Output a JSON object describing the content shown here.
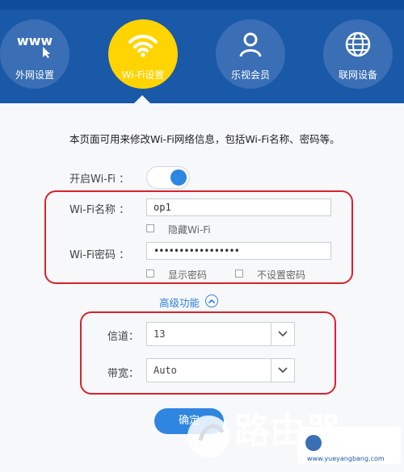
{
  "nav": {
    "items": [
      {
        "label": "外网设置",
        "icon": "www-icon",
        "active": false
      },
      {
        "label": "Wi-Fi设置",
        "icon": "wifi-icon",
        "active": true
      },
      {
        "label": "乐视会员",
        "icon": "user-icon",
        "active": false
      },
      {
        "label": "联网设备",
        "icon": "globe-icon",
        "active": false
      }
    ]
  },
  "page": {
    "description": "本页面可用来修改Wi-Fi网络信息，包括Wi-Fi名称、密码等。"
  },
  "wifi": {
    "toggle_label": "开启Wi-Fi ：",
    "enabled": true,
    "name_label": "Wi-Fi名称 ：",
    "name_value": "op1",
    "hide_label": "隐藏Wi-Fi",
    "password_label": "Wi-Fi密码 ：",
    "password_value": "•••••••••••••••••",
    "show_password_label": "显示密码",
    "no_password_label": "不设置密码"
  },
  "advanced": {
    "label": "高级功能",
    "channel_label": "信道：",
    "channel_value": "13",
    "bandwidth_label": "带宽：",
    "bandwidth_value": "Auto"
  },
  "actions": {
    "confirm_label": "确定"
  },
  "watermark": {
    "text": "路由器",
    "site": "www.yueyangbang.com"
  },
  "colors": {
    "header": "#1a58a8",
    "active_nav": "#ffd400",
    "accent": "#2f86e0",
    "annotation": "#d8232a"
  }
}
